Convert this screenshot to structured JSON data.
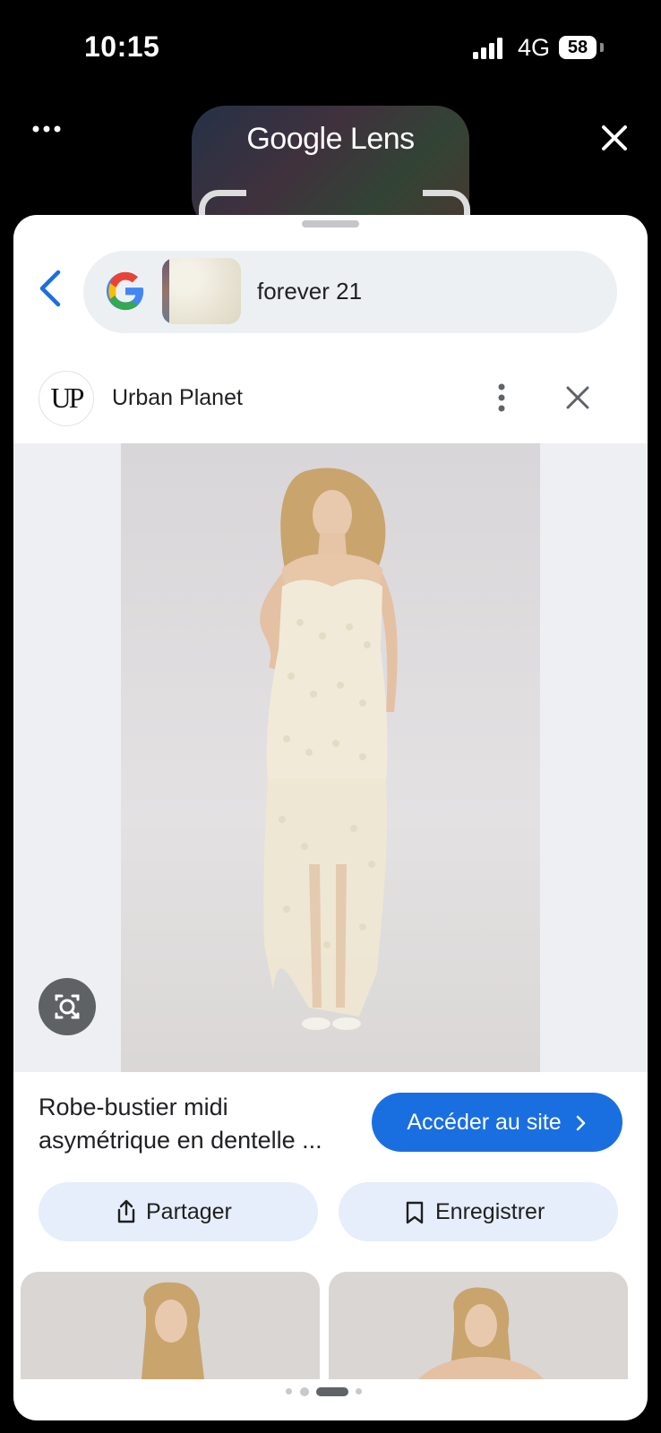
{
  "status_bar": {
    "time": "10:15",
    "network": "4G",
    "battery": "58"
  },
  "lens_header": {
    "title": "Google Lens",
    "more_icon": "more-horizontal-icon",
    "close_icon": "close-icon"
  },
  "search": {
    "back_icon": "chevron-left-icon",
    "logo": "google-g-logo",
    "query": "forever 21"
  },
  "result": {
    "source_logo_text": "UP",
    "source_name": "Urban Planet",
    "product_title": "Robe-bustier midi asymétrique en dentelle ...",
    "visit_label": "Accéder au site",
    "share_label": "Partager",
    "save_label": "Enregistrer"
  },
  "pagination": {
    "count": 4,
    "active": 2
  },
  "colors": {
    "accent": "#1a6fe0",
    "pill_bg": "#e6edfb",
    "search_bg": "#edf0f3"
  }
}
